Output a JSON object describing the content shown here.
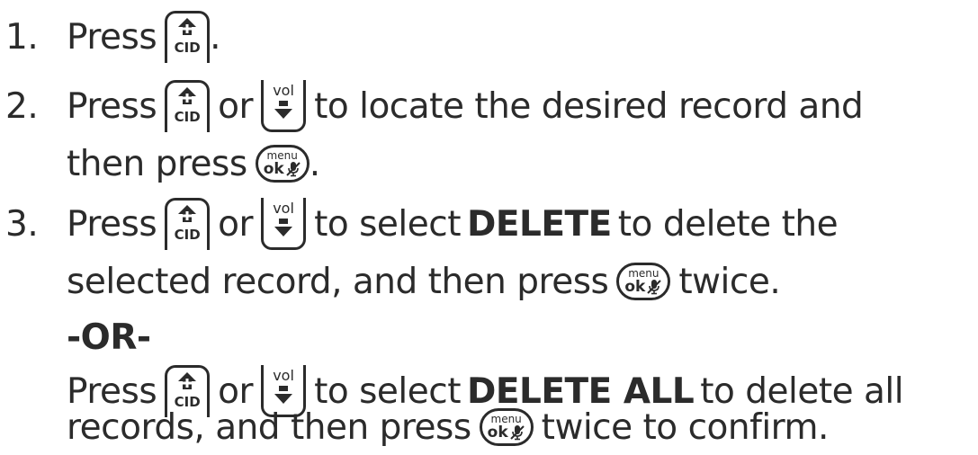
{
  "keys": {
    "cid": "CID",
    "vol": "vol",
    "menu_top": "menu",
    "menu_ok": "ok"
  },
  "step1": {
    "num": "1.",
    "press": "Press",
    "end": "."
  },
  "step2": {
    "num": "2.",
    "press": "Press",
    "or": "or",
    "rest": "to locate the desired record and",
    "then_press": "then press",
    "end": "."
  },
  "step3": {
    "num": "3.",
    "press": "Press",
    "or": "or",
    "to_select": "to select",
    "delete": "DELETE",
    "to_delete_the": "to delete the",
    "selected_record": "selected record, and then press",
    "twice": "twice.",
    "or_label": "-OR-",
    "press2": "Press",
    "or2": "or",
    "to_select2": "to select",
    "delete_all": "DELETE ALL",
    "to_delete_all": "to delete all",
    "records": "records, and then press",
    "twice_confirm": "twice to confirm."
  }
}
